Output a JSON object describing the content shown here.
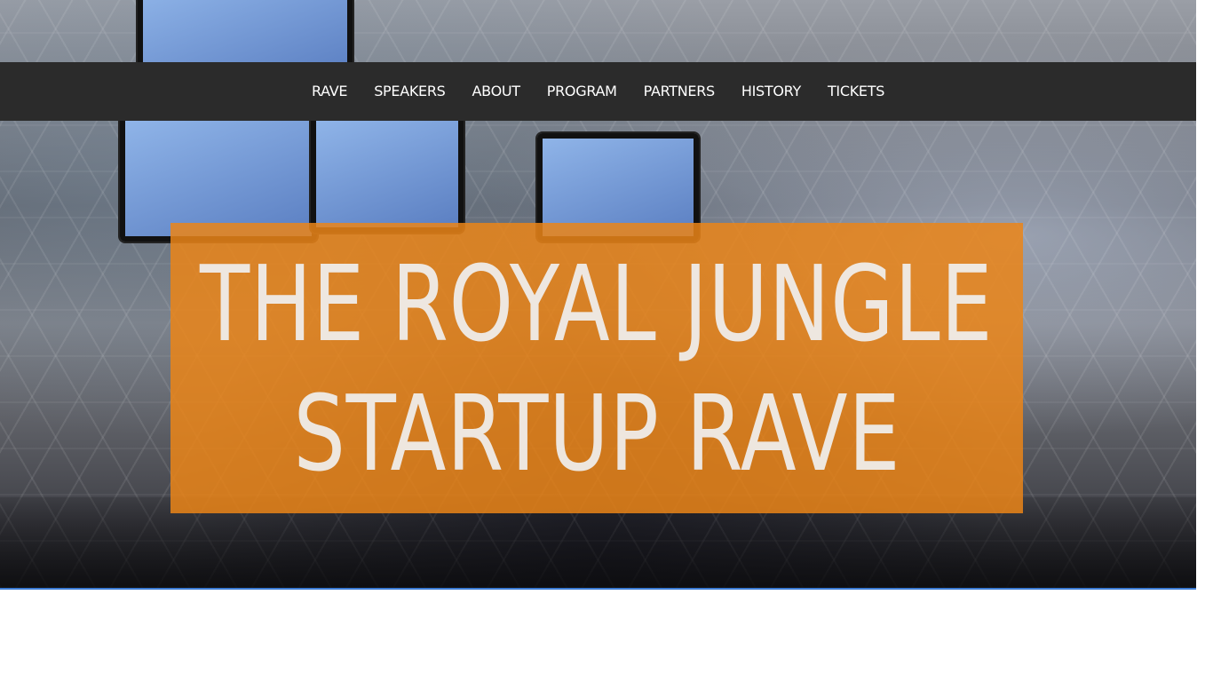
{
  "nav": {
    "items": [
      {
        "label": "RAVE"
      },
      {
        "label": "SPEAKERS"
      },
      {
        "label": "ABOUT"
      },
      {
        "label": "PROGRAM"
      },
      {
        "label": "PARTNERS"
      },
      {
        "label": "HISTORY"
      },
      {
        "label": "TICKETS"
      }
    ]
  },
  "hero": {
    "title_line_1": "THE ROYAL JUNGLE",
    "title_line_2": "STARTUP RAVE"
  },
  "colors": {
    "navbar_bg": "#2b2b2b",
    "title_box_bg": "#eb8518",
    "accent_line": "#3b7bd3"
  }
}
